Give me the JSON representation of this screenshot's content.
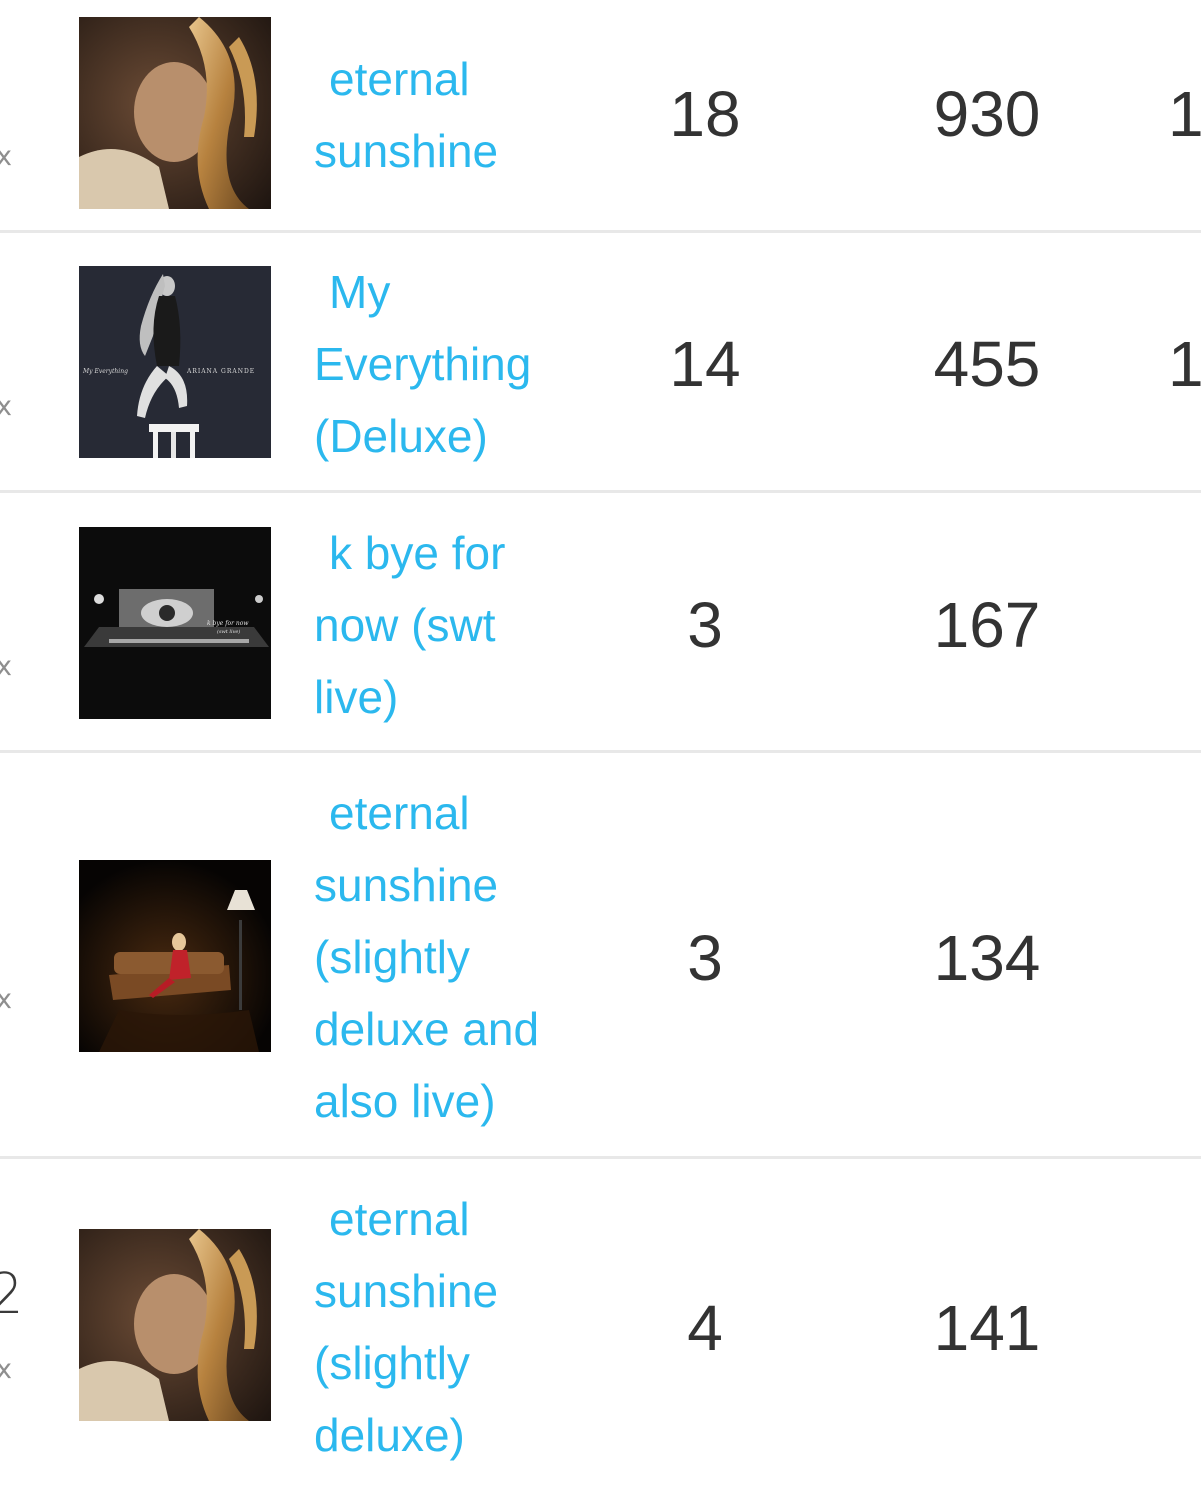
{
  "rows": [
    {
      "mark": "x",
      "title": "eternal sunshine",
      "count": "18",
      "total": "930",
      "extra": "1",
      "cover": "eternal-sunshine-cover"
    },
    {
      "mark": "x",
      "title": "My Everything (Deluxe)",
      "count": "14",
      "total": "455",
      "extra": "1",
      "cover": "my-everything-cover"
    },
    {
      "mark": "x",
      "title": "k bye for now (swt live)",
      "count": "3",
      "total": "167",
      "extra": "",
      "cover": "k-bye-for-now-cover"
    },
    {
      "mark": "x",
      "title": "eternal sunshine (slightly deluxe and also live)",
      "count": "3",
      "total": "134",
      "extra": "",
      "cover": "eternal-sunshine-live-cover"
    },
    {
      "mark": "x",
      "rank_fragment": "2",
      "title": "eternal sunshine (slightly deluxe)",
      "count": "4",
      "total": "141",
      "extra": "",
      "cover": "eternal-sunshine-deluxe-cover"
    }
  ],
  "cover_texts": {
    "my_everything_script": "My Everything",
    "my_everything_artist": "ARIANA GRANDE",
    "k_bye_script": "k bye for now",
    "k_bye_sub": "(swt live)"
  },
  "colors": {
    "link": "#2bb8ee",
    "text": "#333333",
    "divider": "#e8e8e8"
  }
}
